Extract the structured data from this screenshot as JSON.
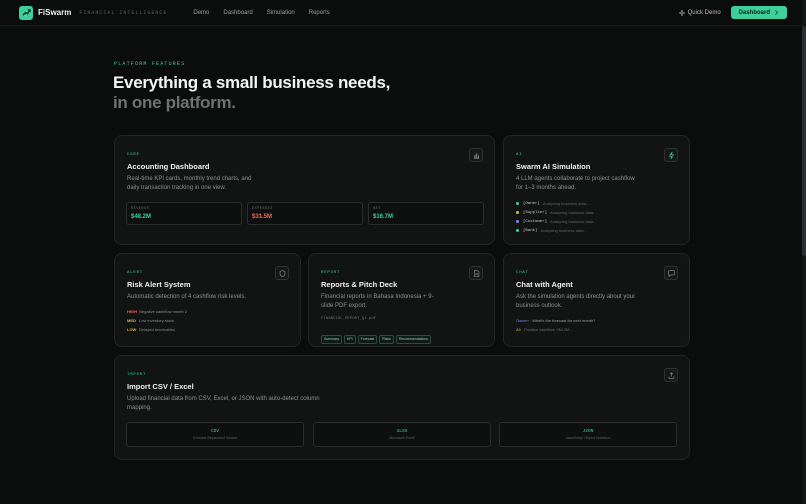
{
  "nav": {
    "brand": "FiSwarm",
    "tagline": "FINANCIAL INTELLIGENCE",
    "links": [
      "Demo",
      "Dashboard",
      "Simulation",
      "Reports"
    ],
    "quick_demo": "Quick Demo",
    "dashboard_btn": "Dashboard"
  },
  "hero": {
    "eyebrow": "PLATFORM FEATURES",
    "line1": "Everything a small business needs,",
    "line2": "in one platform."
  },
  "cards": {
    "accounting": {
      "tag": "CORE",
      "title": "Accounting Dashboard",
      "desc1": "Real-time KPI cards, monthly trend charts, and",
      "desc2": "daily transaction tracking in one view.",
      "kpis": [
        {
          "label": "REVENUE",
          "value": "$48.2M",
          "color": "#3ecf9a"
        },
        {
          "label": "EXPENSES",
          "value": "$31.5M",
          "color": "#ef6b5b"
        },
        {
          "label": "NET",
          "value": "$16.7M",
          "color": "#3ecf9a"
        }
      ]
    },
    "swarm": {
      "tag": "AI",
      "title": "Swarm AI Simulation",
      "desc1": "4 LLM agents collaborate to project cashflow",
      "desc2": "for 1–3 months ahead.",
      "agents": [
        {
          "name": "[Owner]",
          "status": "Analyzing business data...",
          "color": "#3ecf9a"
        },
        {
          "name": "[Supplier]",
          "status": "Analyzing business data...",
          "color": "#e0b43c"
        },
        {
          "name": "[Customer]",
          "status": "Analyzing business data...",
          "color": "#7a8cf0"
        },
        {
          "name": "[Bank]",
          "status": "Analyzing business data...",
          "color": "#3ecf9a"
        }
      ]
    },
    "risk": {
      "tag": "ALERT",
      "title": "Risk Alert System",
      "desc1": "Automatic detection of 4 cashflow risk levels.",
      "levels": [
        {
          "level": "HIGH",
          "text": "Negative cashflow month 2",
          "color": "#ef6b5b"
        },
        {
          "level": "MED",
          "text": "Low inventory stock",
          "color": "#e0b43c"
        },
        {
          "level": "LOW",
          "text": "Delayed receivables",
          "color": "#e0b43c"
        }
      ]
    },
    "reports": {
      "tag": "REPORT",
      "title": "Reports & Pitch Deck",
      "desc1": "Financial reports in Bahasa Indonesia + 9-",
      "desc2": "slide PDF export.",
      "file": "FINANCIAL_REPORT_Q1.pdf",
      "pills": [
        "Summary",
        "KPI",
        "Forecast",
        "Risks",
        "Recommendations"
      ]
    },
    "chat": {
      "tag": "CHAT",
      "title": "Chat with Agent",
      "desc1": "Ask the simulation agents directly about your",
      "desc2": "business outlook.",
      "user_prefix": "Owner›",
      "user_msg": "What's the forecast for next month?",
      "ai_prefix": "AI›",
      "ai_msg": "Positive cashflow +$4.2M..."
    },
    "import": {
      "tag": "IMPORT",
      "title": "Import CSV / Excel",
      "desc1": "Upload financial data from CSV, Excel, or JSON with auto-detect column",
      "desc2": "mapping.",
      "formats": [
        {
          "fmt": "CSV",
          "desc": "Comma Separated Values"
        },
        {
          "fmt": "XLSX",
          "desc": "Microsoft Excel"
        },
        {
          "fmt": "JSON",
          "desc": "JavaScript Object Notation"
        }
      ]
    }
  },
  "colors": {
    "accent": "#3ecf9a",
    "danger": "#ef6b5b",
    "warn": "#e0b43c"
  }
}
